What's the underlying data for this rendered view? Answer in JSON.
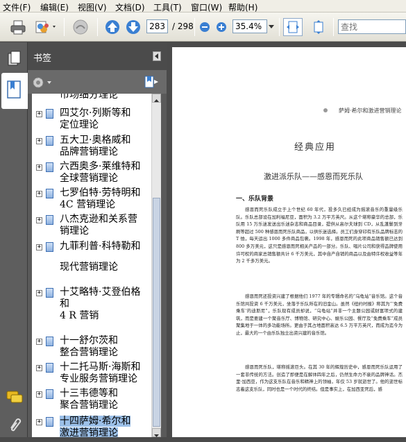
{
  "menu": [
    "文件(F)",
    "编辑(E)",
    "视图(V)",
    "文档(D)",
    "工具(T)",
    "窗口(W)",
    "帮助(H)"
  ],
  "toolbar": {
    "page_current": "283",
    "page_total": "/ 298",
    "zoom": "35.4%",
    "search_placeholder": "查找"
  },
  "panel": {
    "title": "书签"
  },
  "bookmarks": [
    {
      "lines": [
        "市场细分理论"
      ],
      "selected": false,
      "plus": false
    },
    {
      "lines": [
        "四艾尔·列斯等和",
        "定位理论"
      ],
      "selected": false,
      "plus": true
    },
    {
      "lines": [
        "五大卫·奥格威和",
        "品牌营销理论"
      ],
      "selected": false,
      "plus": true
    },
    {
      "lines": [
        "六西奥多·莱维特和",
        "全球营销理论"
      ],
      "selected": false,
      "plus": true
    },
    {
      "lines": [
        "七罗伯特·劳特明和",
        "4C 营销理论"
      ],
      "selected": false,
      "plus": true
    },
    {
      "lines": [
        "八杰克逊和关系营",
        "销理论"
      ],
      "selected": false,
      "plus": true
    },
    {
      "lines": [
        "九菲利普·科特勒和"
      ],
      "selected": false,
      "plus": true
    },
    {
      "lines": [
        "现代营销理论"
      ],
      "selected": false,
      "plus": false
    },
    {
      "lines": [
        "十艾略特·艾登伯格",
        "和",
        "4 R 营销"
      ],
      "selected": false,
      "plus": true
    },
    {
      "lines": [
        "十一舒尔茨和",
        "整合营销理论"
      ],
      "selected": false,
      "plus": true
    },
    {
      "lines": [
        "十二托马斯·海斯和",
        "专业服务营销理论"
      ],
      "selected": false,
      "plus": true
    },
    {
      "lines": [
        "十三韦德等和",
        "聚合营销理论"
      ],
      "selected": false,
      "plus": true
    },
    {
      "lines": [
        "十四萨姆·希尔和",
        "激进营销理论"
      ],
      "selected": true,
      "plus": true
    }
  ],
  "document": {
    "running_header": "萨姆·希尔和激进营销理论",
    "section_title": "经典应用",
    "article_title": "激进派乐队——感恩而死乐队",
    "heading_1": "一、乐队背景",
    "para_1": "感恩而死乐队成立于上个世纪 60 年代，投多久已经成为摇滚音乐的重量级乐队。乐队总部设在加利福尼亚，面积为 3.2 万平方英尺。从这个堪称豪华的总部，乐队用 15 万乐迷发送出乐迷杂志和商品目录，提供从高尔夫球到 CD，从乱蓬鬃到牙刷等超过 500 种感恩而死乐队商品，以供乐迷选择。员工们身穿印有乐队品牌标志的 T 恤，每天运出 1000 多件商品包裹。1998 年，感恩而死的此项商品销售额已达到 800 多万美元，这只是感恩而死相关产品的一部分。乐队、唱片公司和获得品牌使用许可权的商家总销售额共计 6 千万美元，其中自产自销的商品以及由特许权收益等年为 2 千多万美元。",
    "para_2": "感恩而死还投资兴建了根据他们 1977 年的专辑命名的“乌龟站”音乐馆。这个音乐馆共投资 6 千万美元，坐落于乐队所在的旧金山。虽然《纽约时报》称其为“‘免费乘车’的迪斯尼”，乐队现有成员却说，“乌龟站”并非一个主题公园或财富项式的建筑，而是要建一个聚音乐厅、博物馆、研究中心、娱乐公园、餐厅及“免费乘车”成员聚集地于一体的多功能场所。更由于其占地面积高达 6.5 万平方英尺，而成为迄今为止，最大的一个由乐队独立出资兴建的音乐馆。",
    "para_3": "感恩而死乐队，堪称摇滚巨头。在其 30 年的辉煌历史中，感恩而死乐队运用了一套非传统的方法。创造了即便是在解体四年之后，仍然生命力不衰的品牌神话。杰里·加西亚，作为这支乐队在音乐和精神上的领袖，年仅 53 岁就逝世了。他的逝世标志着这支乐队，同时也是一个时代的终结。但是事实上，在加西亚死后，感"
  }
}
